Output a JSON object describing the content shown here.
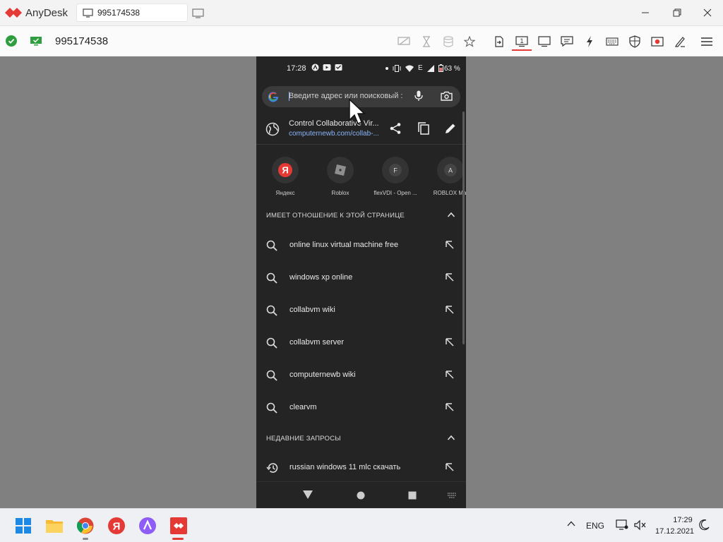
{
  "window": {
    "app_name": "AnyDesk",
    "tab_label": "995174538",
    "accent_color": "#e53935"
  },
  "toolbar": {
    "session_id": "995174538",
    "icons": [
      "privacy-icon",
      "hourglass-icon",
      "database-icon",
      "star-icon",
      "file-transfer-icon",
      "monitor-1-icon",
      "display-icon",
      "chat-icon",
      "action-icon",
      "keyboard-icon",
      "permissions-icon",
      "record-icon",
      "whiteboard-icon",
      "menu-icon"
    ]
  },
  "phone": {
    "status": {
      "time": "17:28",
      "battery": "63 %"
    },
    "search": {
      "placeholder": "Введите адрес или поисковый :"
    },
    "current_page": {
      "title": "Control Collaborative Vir...",
      "url": "computernewb.com/collab-..."
    },
    "tiles": [
      {
        "label": "Яндекс",
        "letter": "Я"
      },
      {
        "label": "Roblox",
        "letter": ""
      },
      {
        "label": "flexVDI - Open ...",
        "letter": "F"
      },
      {
        "label": "ROBLOX Mai",
        "letter": "A"
      }
    ],
    "sections": {
      "related": "ИМЕЕТ ОТНОШЕНИЕ К ЭТОЙ СТРАНИЦЕ",
      "recent": "НЕДАВНИЕ ЗАПРОСЫ"
    },
    "suggestions": [
      "online linux virtual machine free",
      "windows xp online",
      "collabvm wiki",
      "collabvm server",
      "computernewb wiki",
      "clearvm"
    ],
    "recent_queries": [
      "russian windows 11 mlc скачать"
    ]
  },
  "taskbar": {
    "language": "ENG",
    "clock_time": "17:29",
    "clock_date": "17.12.2021"
  }
}
